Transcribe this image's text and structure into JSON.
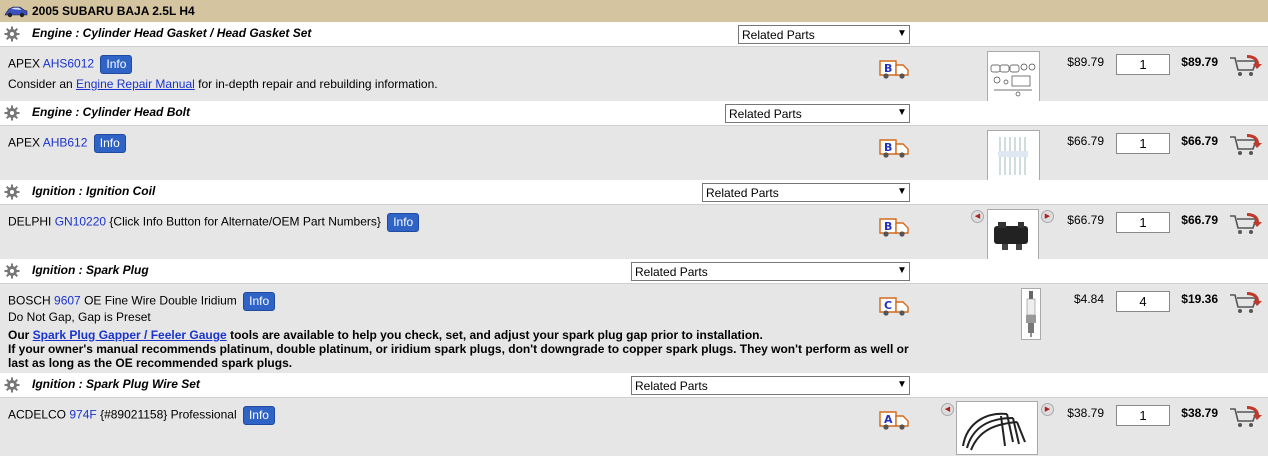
{
  "vehicle": {
    "title": "2005 SUBARU BAJA 2.5L H4"
  },
  "categories": [
    {
      "title": "Engine : Cylinder Head Gasket / Head Gasket Set",
      "related": "Related Parts"
    },
    {
      "title": "Engine : Cylinder Head Bolt",
      "related": "Related Parts"
    },
    {
      "title": "Ignition : Ignition Coil",
      "related": "Related Parts"
    },
    {
      "title": "Ignition : Spark Plug",
      "related": "Related Parts"
    },
    {
      "title": "Ignition : Spark Plug Wire Set",
      "related": "Related Parts"
    }
  ],
  "parts": [
    {
      "brand": "APEX",
      "part_number": "AHS6012",
      "suffix": "",
      "info": "Info",
      "note_pre": "Consider an ",
      "note_link": "Engine Repair Manual",
      "note_post": " for in-depth repair and rebuilding information.",
      "pop_letter": "B",
      "price": "$89.79",
      "qty": "1",
      "total": "$89.79"
    },
    {
      "brand": "APEX",
      "part_number": "AHB612",
      "suffix": "",
      "info": "Info",
      "pop_letter": "B",
      "price": "$66.79",
      "qty": "1",
      "total": "$66.79"
    },
    {
      "brand": "DELPHI",
      "part_number": "GN10220",
      "suffix": "{Click Info Button for Alternate/OEM Part Numbers}",
      "info": "Info",
      "pop_letter": "B",
      "price": "$66.79",
      "qty": "1",
      "total": "$66.79"
    },
    {
      "brand": "BOSCH",
      "part_number": "9607",
      "suffix": "OE Fine Wire Double Iridium",
      "info": "Info",
      "spec": "Do Not Gap, Gap is Preset",
      "guide_pre": "Our ",
      "guide_link": "Spark Plug Gapper / Feeler Gauge",
      "guide_post": " tools are available to help you check, set, and adjust your spark plug gap prior to installation.",
      "warning": "If your owner's manual recommends platinum, double platinum, or iridium spark plugs, don't downgrade to copper spark plugs. They won't perform as well or last as long as the OE recommended spark plugs.",
      "pop_letter": "C",
      "price": "$4.84",
      "qty": "4",
      "total": "$19.36"
    },
    {
      "brand": "ACDELCO",
      "part_number": "974F",
      "suffix": "{#89021158} Professional",
      "info": "Info",
      "pop_letter": "A",
      "price": "$38.79",
      "qty": "1",
      "total": "$38.79"
    }
  ],
  "icons": {
    "vehicle": "car-icon",
    "category": "gear-icon",
    "popularity": "delivery-truck-icon",
    "cart": "add-to-cart-icon",
    "prev": "arrow-left-icon",
    "next": "arrow-right-icon"
  },
  "colors": {
    "vehicle_bar": "#d4c4a0",
    "part_row": "#e6e6e6",
    "link": "#1a33cc",
    "info_button": "#2f63c6",
    "cart_arrow": "#c0392b"
  }
}
